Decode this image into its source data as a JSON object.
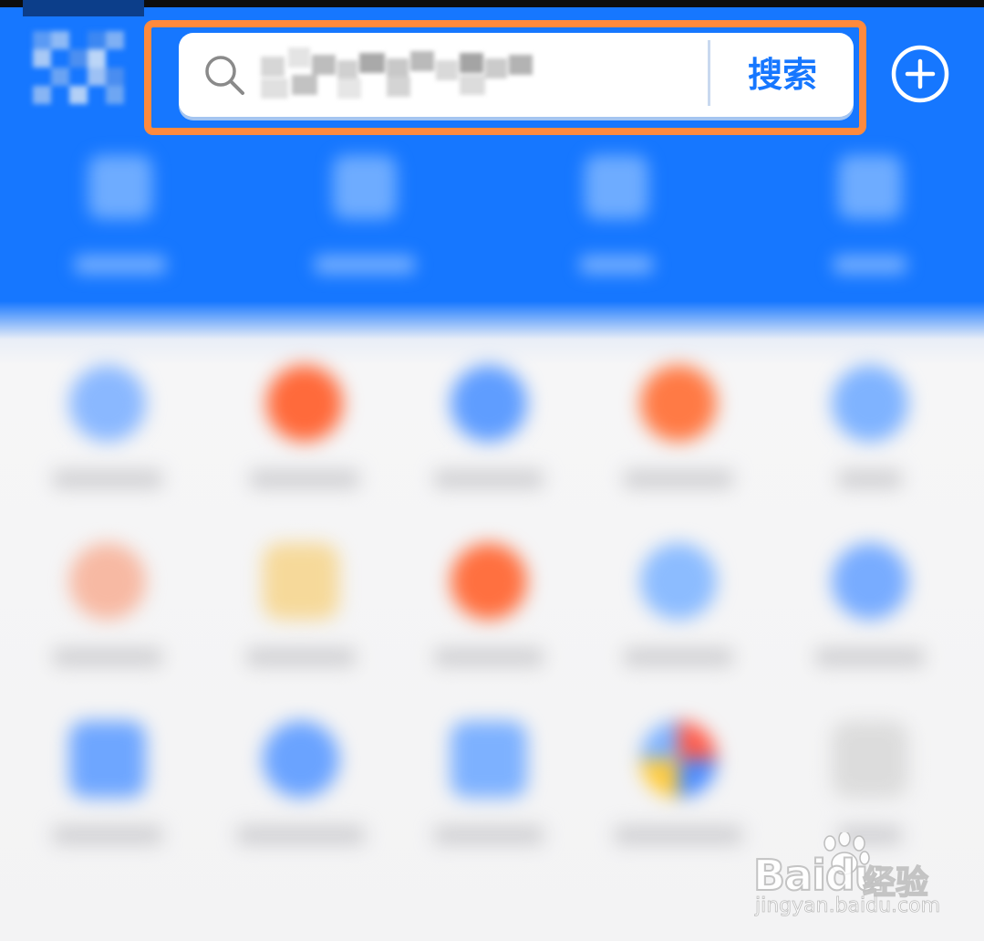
{
  "header": {
    "search": {
      "placeholder": "",
      "value": "",
      "button_label": "搜索"
    },
    "add_icon": "plus-circle-icon",
    "search_icon": "magnifier-icon"
  },
  "colors": {
    "brand_blue": "#1677ff",
    "highlight_orange": "#ff8a3d",
    "background": "#f4f5f7"
  },
  "watermark": {
    "brand": "Baidu",
    "suffix": "经验",
    "url": "jingyan.baidu.com"
  }
}
